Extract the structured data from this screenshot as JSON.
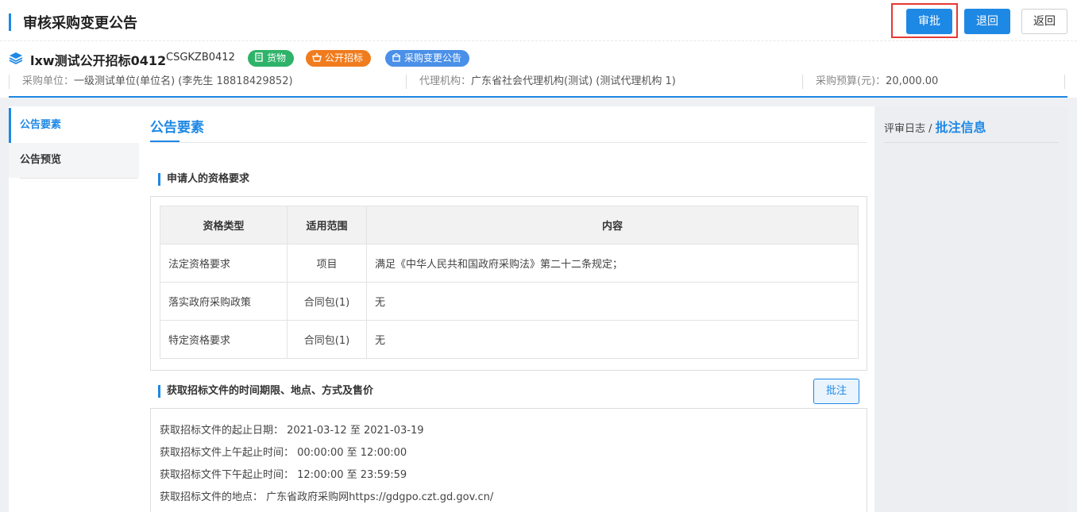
{
  "header": {
    "title": "审核采购变更公告",
    "approve_label": "审批",
    "reject_label": "退回",
    "back_label": "返回"
  },
  "project": {
    "name": "lxw测试公开招标0412",
    "code": "CSGKZB0412",
    "tags": [
      "货物",
      "公开招标",
      "采购变更公告"
    ]
  },
  "info": {
    "buyer_label": "采购单位：",
    "buyer_value": "一级测试单位(单位名) (李先生 18818429852)",
    "agent_label": "代理机构：",
    "agent_value": "广东省社会代理机构(测试) (测试代理机构 1)",
    "budget_label": "采购预算(元)：",
    "budget_value": "20,000.00"
  },
  "nav": {
    "items": [
      "公告要素",
      "公告预览"
    ]
  },
  "main": {
    "title": "公告要素",
    "section1": "申请人的资格要求",
    "table": {
      "headers": [
        "资格类型",
        "适用范围",
        "内容"
      ],
      "rows": [
        [
          "法定资格要求",
          "项目",
          "满足《中华人民共和国政府采购法》第二十二条规定；"
        ],
        [
          "落实政府采购政策",
          "合同包(1)",
          "无"
        ],
        [
          "特定资格要求",
          "合同包(1)",
          "无"
        ]
      ]
    },
    "section2": "获取招标文件的时间期限、地点、方式及售价",
    "annotate_label": "批注",
    "doc_lines": [
      "获取招标文件的起止日期：  2021-03-12 至 2021-03-19",
      "获取招标文件上午起止时间：  00:00:00 至 12:00:00",
      "获取招标文件下午起止时间：  12:00:00 至 23:59:59",
      "获取招标文件的地点：  广东省政府采购网https://gdgpo.czt.gd.gov.cn/"
    ]
  },
  "right": {
    "log_label": "评审日志 / ",
    "annotation_label": "批注信息"
  },
  "colors": {
    "accent": "#1e88e5",
    "tag_goods": "#2fb36a",
    "tag_method": "#f07c1e",
    "tag_notice": "#4a90e8",
    "highlight": "#e53935"
  }
}
